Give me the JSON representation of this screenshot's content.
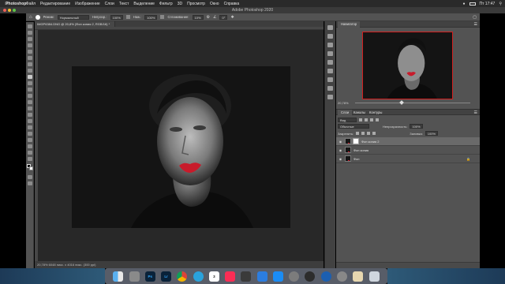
{
  "menubar": {
    "items": [
      "Photoshop",
      "Файл",
      "Редактирование",
      "Изображение",
      "Слои",
      "Текст",
      "Выделение",
      "Фильтр",
      "3D",
      "Просмотр",
      "Окно",
      "Справка"
    ],
    "clock": "Пт 17:47"
  },
  "window": {
    "title": "Adobe Photoshop 2020"
  },
  "options_bar": {
    "mode_label": "Режим:",
    "mode_value": "Нормальный",
    "opacity_label": "Непрозр.:",
    "opacity_value": "100%",
    "pressure_label": "Наж.:",
    "pressure_value": "100%",
    "smoothing_label": "Сглаживание:",
    "smoothing_value": "10%",
    "angle_value": "0°"
  },
  "document": {
    "tab_title": "IMGP6384.DNG @ 20,8% (Фон копия 2, RGB/16) *",
    "status": "20,78%   6048 пикс. x 4016 пикс. (300 ppi)"
  },
  "navigator": {
    "tab_label": "Навигатор",
    "zoom": "20,78%"
  },
  "layers_panel": {
    "tabs": [
      "Слои",
      "Каналы",
      "Контуры"
    ],
    "filter_label": "Вид",
    "blend_mode": "Обычные",
    "opacity_label": "Непрозрачность:",
    "opacity_value": "100%",
    "lock_label": "Закрепить:",
    "fill_label": "Заливка:",
    "fill_value": "100%",
    "layers": [
      {
        "name": "Фон копия 2",
        "selected": true,
        "mask": true
      },
      {
        "name": "Фон копия",
        "selected": false,
        "mask": false
      },
      {
        "name": "Фон",
        "selected": false,
        "mask": false
      }
    ]
  },
  "dock": {
    "apps": [
      "finder-icon",
      "launchpad-icon",
      "photoshop-icon",
      "lightroom-icon",
      "chrome-icon",
      "telegram-icon",
      "calendar-icon",
      "music-icon",
      "finalcut-icon",
      "keynote-icon",
      "appstore-icon",
      "settings-icon",
      "quicktime-icon",
      "spotlight-icon",
      "system-prefs-icon",
      "preview-icon",
      "trash-icon"
    ],
    "ps_label": "Ps",
    "lr_label": "Lr"
  },
  "colors": {
    "lipstick": "#c81b2b",
    "nav_frame": "#d21f1f",
    "panel_bg": "#535353"
  }
}
